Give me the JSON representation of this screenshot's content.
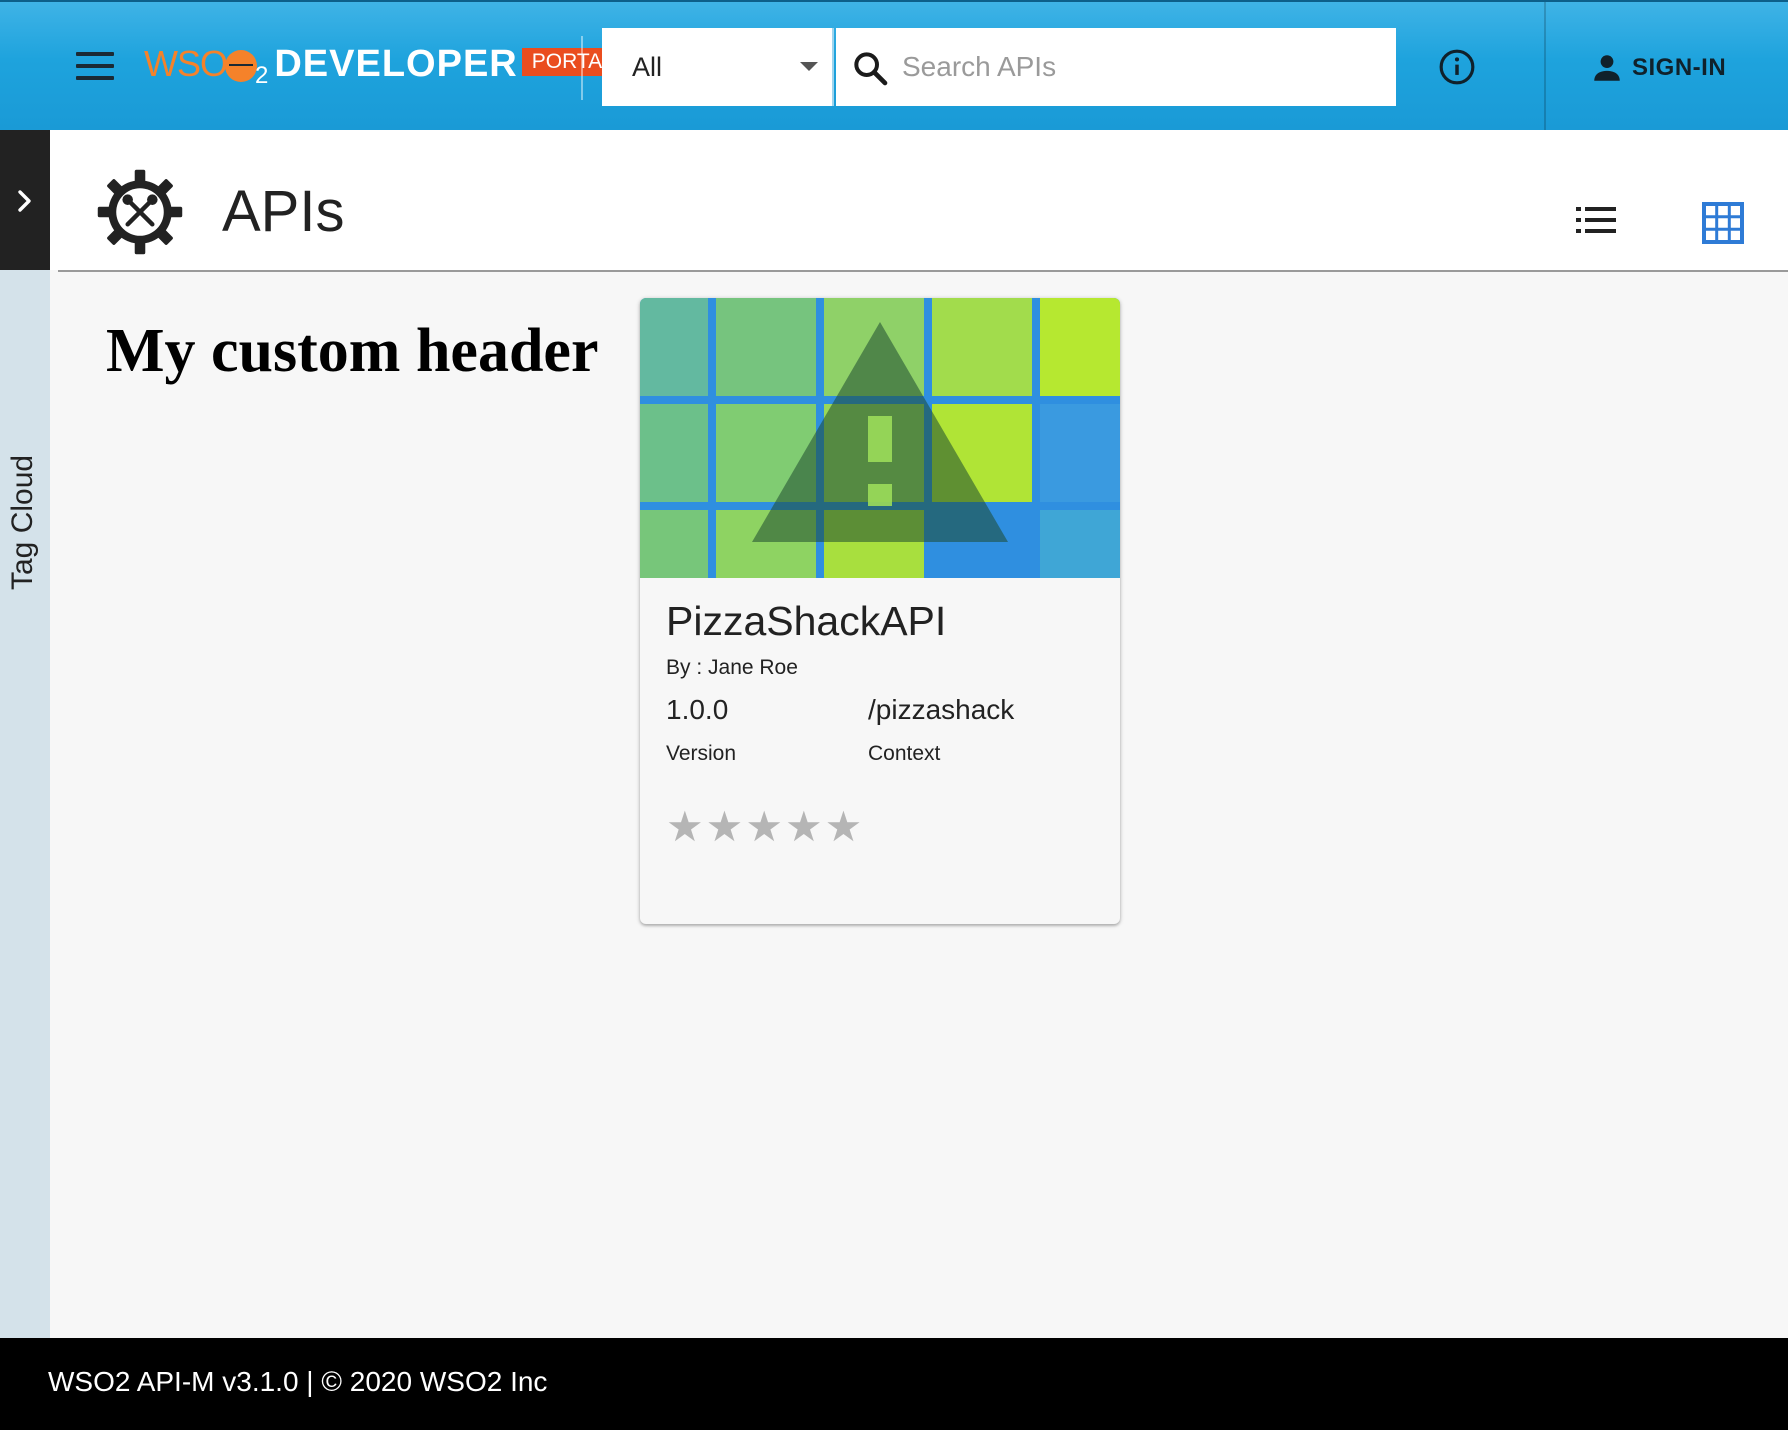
{
  "header": {
    "logo": {
      "wso": "WSO",
      "two": "2",
      "developer": "DEVELOPER",
      "portal": "PORTAL"
    },
    "filter_select": {
      "value": "All"
    },
    "search": {
      "placeholder": "Search APIs"
    },
    "sign_in_label": "SIGN-IN",
    "colors": {
      "bar": "#1ea3dd",
      "logo_orange": "#f5822a",
      "portal_badge": "#ea4d1f"
    }
  },
  "sidebar": {
    "tag_cloud_label": "Tag Cloud"
  },
  "page": {
    "title": "APIs",
    "custom_header": "My custom header",
    "active_view": "grid"
  },
  "apis": [
    {
      "name": "PizzaShackAPI",
      "by": "By : Jane Roe",
      "version": "1.0.0",
      "version_label": "Version",
      "context": "/pizzashack",
      "context_label": "Context",
      "rating": 0,
      "rating_max": 5
    }
  ],
  "footer": {
    "text": "WSO2 API-M v3.1.0 | © 2020 WSO2 Inc"
  },
  "icons": [
    "menu-icon",
    "chevron-down-icon",
    "search-icon",
    "info-icon",
    "person-icon",
    "chevron-right-icon",
    "gear-tools-icon",
    "list-view-icon",
    "grid-view-icon",
    "warning-icon",
    "star-icon"
  ]
}
